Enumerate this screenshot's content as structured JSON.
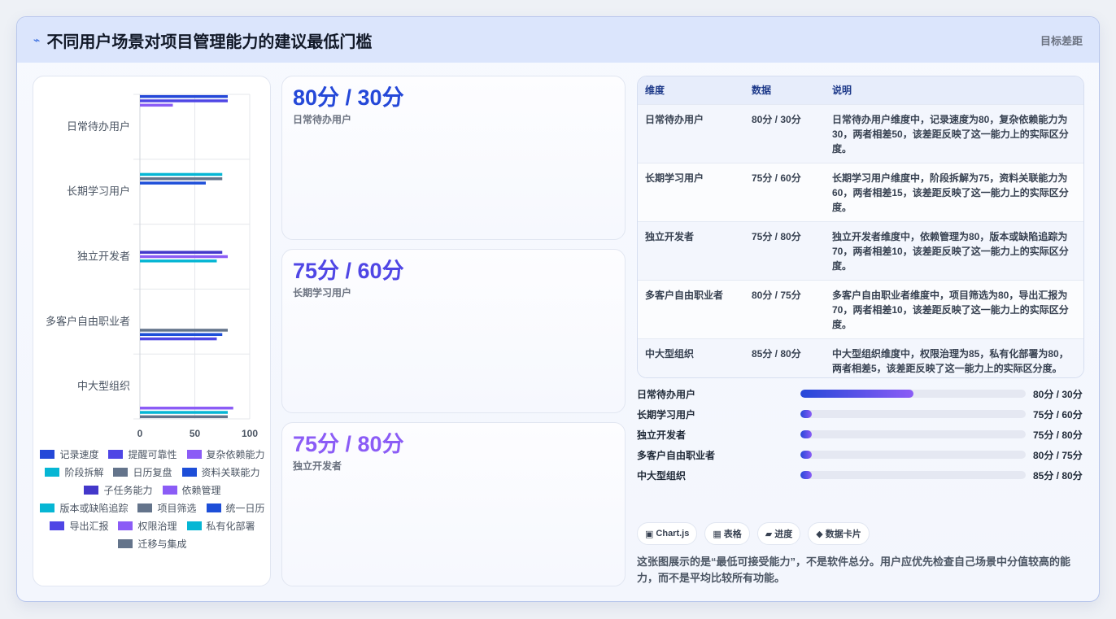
{
  "header": {
    "title": "不同用户场景对项目管理能力的建议最低门槛",
    "right_label": "目标差距",
    "icon": "bolt-icon"
  },
  "chart_data": {
    "type": "bar",
    "orientation": "horizontal",
    "categories": [
      "日常待办用户",
      "长期学习用户",
      "独立开发者",
      "多客户自由职业者",
      "中大型组织"
    ],
    "xlim": [
      0,
      100
    ],
    "xticks": [
      0,
      50,
      100
    ],
    "grid": true,
    "legend_position": "bottom",
    "series": [
      {
        "name": "记录速度",
        "color": "#2548d8",
        "values": [
          80,
          null,
          null,
          null,
          null
        ]
      },
      {
        "name": "提醒可靠性",
        "color": "#4f46e5",
        "values": [
          80,
          null,
          null,
          null,
          null
        ]
      },
      {
        "name": "复杂依赖能力",
        "color": "#8b5cf6",
        "values": [
          30,
          null,
          null,
          null,
          null
        ]
      },
      {
        "name": "阶段拆解",
        "color": "#06b6d4",
        "values": [
          null,
          75,
          null,
          null,
          null
        ]
      },
      {
        "name": "日历复盘",
        "color": "#64748b",
        "values": [
          null,
          75,
          null,
          null,
          null
        ]
      },
      {
        "name": "资料关联能力",
        "color": "#1d4ed8",
        "values": [
          null,
          60,
          null,
          null,
          null
        ]
      },
      {
        "name": "子任务能力",
        "color": "#4338ca",
        "values": [
          null,
          null,
          75,
          null,
          null
        ]
      },
      {
        "name": "依赖管理",
        "color": "#8b5cf6",
        "values": [
          null,
          null,
          80,
          null,
          null
        ]
      },
      {
        "name": "版本或缺陷追踪",
        "color": "#06b6d4",
        "values": [
          null,
          null,
          70,
          null,
          null
        ]
      },
      {
        "name": "项目筛选",
        "color": "#64748b",
        "values": [
          null,
          null,
          null,
          80,
          null
        ]
      },
      {
        "name": "统一日历",
        "color": "#1d4ed8",
        "values": [
          null,
          null,
          null,
          75,
          null
        ]
      },
      {
        "name": "导出汇报",
        "color": "#4f46e5",
        "values": [
          null,
          null,
          null,
          70,
          null
        ]
      },
      {
        "name": "权限治理",
        "color": "#8b5cf6",
        "values": [
          null,
          null,
          null,
          null,
          85
        ]
      },
      {
        "name": "私有化部署",
        "color": "#06b6d4",
        "values": [
          null,
          null,
          null,
          null,
          80
        ]
      },
      {
        "name": "迁移与集成",
        "color": "#64748b",
        "values": [
          null,
          null,
          null,
          null,
          80
        ]
      }
    ]
  },
  "cards": [
    {
      "value": "80分 / 30分",
      "label": "日常待办用户",
      "color": "#2548d8"
    },
    {
      "value": "75分 / 60分",
      "label": "长期学习用户",
      "color": "#4f46e5"
    },
    {
      "value": "75分 / 80分",
      "label": "独立开发者",
      "color": "#8b5cf6"
    }
  ],
  "table": {
    "headers": [
      "维度",
      "数据",
      "说明"
    ],
    "rows": [
      [
        "日常待办用户",
        "80分 / 30分",
        "日常待办用户维度中，记录速度为80，复杂依赖能力为30，两者相差50，该差距反映了这一能力上的实际区分度。"
      ],
      [
        "长期学习用户",
        "75分 / 60分",
        "长期学习用户维度中，阶段拆解为75，资料关联能力为60，两者相差15，该差距反映了这一能力上的实际区分度。"
      ],
      [
        "独立开发者",
        "75分 / 80分",
        "独立开发者维度中，依赖管理为80，版本或缺陷追踪为70，两者相差10，该差距反映了这一能力上的实际区分度。"
      ],
      [
        "多客户自由职业者",
        "80分 / 75分",
        "多客户自由职业者维度中，项目筛选为80，导出汇报为70，两者相差10，该差距反映了这一能力上的实际区分度。"
      ],
      [
        "中大型组织",
        "85分 / 80分",
        "中大型组织维度中，权限治理为85，私有化部署为80，两者相差5，该差距反映了这一能力上的实际区分度。"
      ]
    ]
  },
  "progress": [
    {
      "label": "日常待办用户",
      "value": "80分 / 30分",
      "fraction": 0.5
    },
    {
      "label": "长期学习用户",
      "value": "75分 / 60分",
      "fraction": 0.05
    },
    {
      "label": "独立开发者",
      "value": "75分 / 80分",
      "fraction": 0.05
    },
    {
      "label": "多客户自由职业者",
      "value": "80分 / 75分",
      "fraction": 0.05
    },
    {
      "label": "中大型组织",
      "value": "85分 / 80分",
      "fraction": 0.05
    }
  ],
  "chips": [
    {
      "icon": "▣",
      "label": "Chart.js"
    },
    {
      "icon": "▦",
      "label": "表格"
    },
    {
      "icon": "▰",
      "label": "进度"
    },
    {
      "icon": "◆",
      "label": "数据卡片"
    }
  ],
  "note": "这张图展示的是“最低可接受能力”，不是软件总分。用户应优先检查自己场景中分值较高的能力，而不是平均比较所有功能。"
}
